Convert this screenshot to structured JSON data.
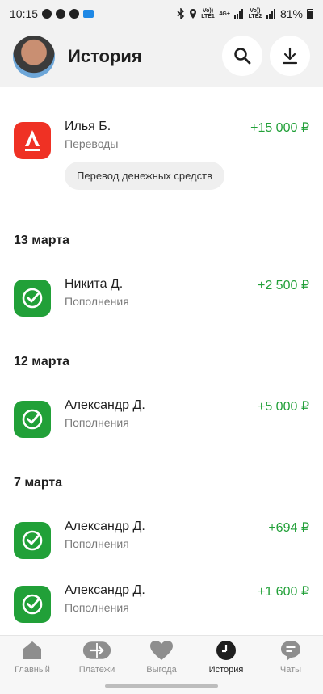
{
  "status_bar": {
    "time": "10:15",
    "sim1": "Vo)) LTE1",
    "sim2": "Vo)) LTE2",
    "network": "4G+",
    "battery": "81%"
  },
  "header": {
    "title": "История",
    "avatar": "avatar",
    "search_icon": "search-icon",
    "download_icon": "download-icon"
  },
  "groups": [
    {
      "date": "",
      "transactions": [
        {
          "icon": "alfa-bank-icon",
          "name": "Илья Б.",
          "category": "Переводы",
          "amount": "+15 000 ₽",
          "chip": "Перевод денежных средств"
        }
      ]
    },
    {
      "date": "13 марта",
      "transactions": [
        {
          "icon": "sber-icon",
          "name": "Никита Д.",
          "category": "Пополнения",
          "amount": "+2 500 ₽"
        }
      ]
    },
    {
      "date": "12 марта",
      "transactions": [
        {
          "icon": "sber-icon",
          "name": "Александр Д.",
          "category": "Пополнения",
          "amount": "+5 000 ₽"
        }
      ]
    },
    {
      "date": "7 марта",
      "transactions": [
        {
          "icon": "sber-icon",
          "name": "Александр Д.",
          "category": "Пополнения",
          "amount": "+694 ₽"
        },
        {
          "icon": "sber-icon",
          "name": "Александр Д.",
          "category": "Пополнения",
          "amount": "+1 600 ₽"
        }
      ]
    }
  ],
  "bottom_nav": [
    {
      "label": "Главный",
      "icon": "home-icon",
      "active": false
    },
    {
      "label": "Платежи",
      "icon": "transfer-icon",
      "active": false
    },
    {
      "label": "Выгода",
      "icon": "heart-icon",
      "active": false
    },
    {
      "label": "История",
      "icon": "clock-icon",
      "active": true
    },
    {
      "label": "Чаты",
      "icon": "chat-icon",
      "active": false
    }
  ],
  "colors": {
    "accent_green": "#21a038",
    "alfa_red": "#ef3124",
    "header_bg": "#f2f2f2"
  }
}
